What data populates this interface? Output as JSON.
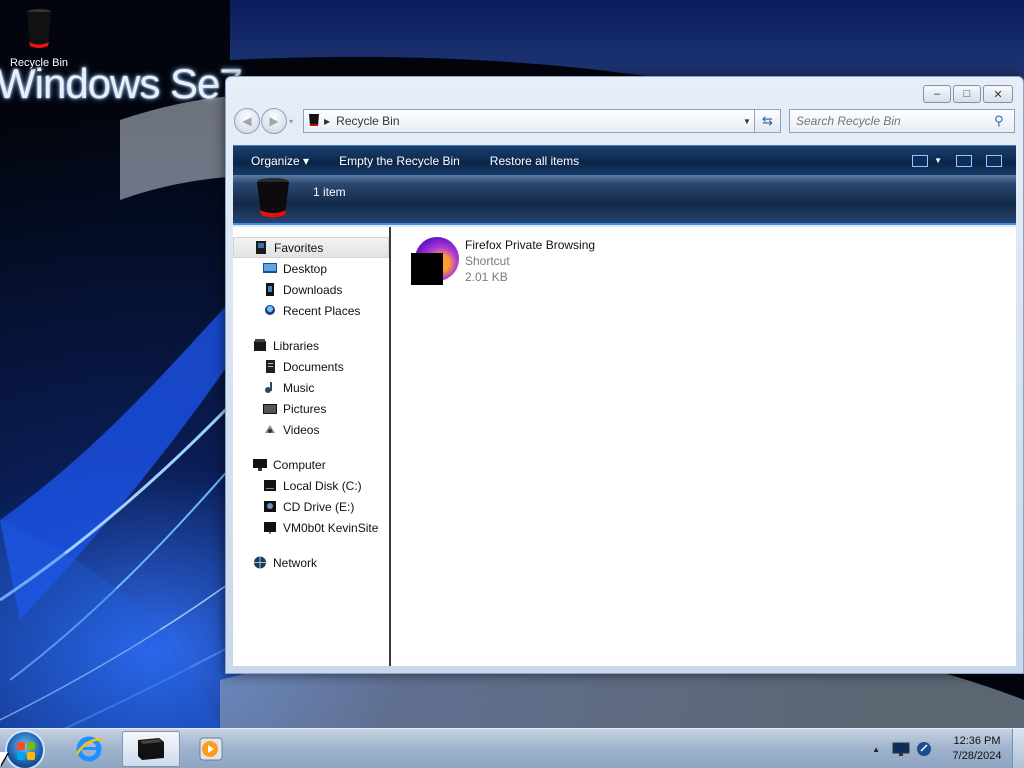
{
  "desktop": {
    "brand_text": "Windows Se7",
    "icons": [
      {
        "label": "Recycle Bin",
        "icon": "recycle-bin-icon"
      }
    ]
  },
  "window": {
    "caption_buttons": {
      "minimize": "–",
      "maximize": "□",
      "close": "✕"
    },
    "address": {
      "location": "Recycle Bin"
    },
    "search": {
      "placeholder": "Search Recycle Bin"
    },
    "toolbar": {
      "organize": "Organize",
      "empty": "Empty the Recycle Bin",
      "restore": "Restore all items"
    },
    "header": {
      "count": "1 item"
    },
    "nav": {
      "favorites": {
        "label": "Favorites",
        "items": [
          "Desktop",
          "Downloads",
          "Recent Places"
        ]
      },
      "libraries": {
        "label": "Libraries",
        "items": [
          "Documents",
          "Music",
          "Pictures",
          "Videos"
        ]
      },
      "computer": {
        "label": "Computer",
        "items": [
          "Local Disk (C:)",
          "CD Drive (E:)",
          "VM0b0t KevinSite"
        ]
      },
      "network": {
        "label": "Network"
      }
    },
    "files": [
      {
        "name": "Firefox Private Browsing",
        "type": "Shortcut",
        "size": "2.01 KB"
      }
    ]
  },
  "taskbar": {
    "pinned": [
      "start-orb",
      "internet-explorer-icon",
      "explorer-icon",
      "media-player-icon"
    ],
    "clock": {
      "time": "12:36 PM",
      "date": "7/28/2024"
    }
  },
  "colors": {
    "accent": "#3b8ff0",
    "toolbar": "#0f2d54",
    "firefox_purple": "#6a16c6"
  }
}
